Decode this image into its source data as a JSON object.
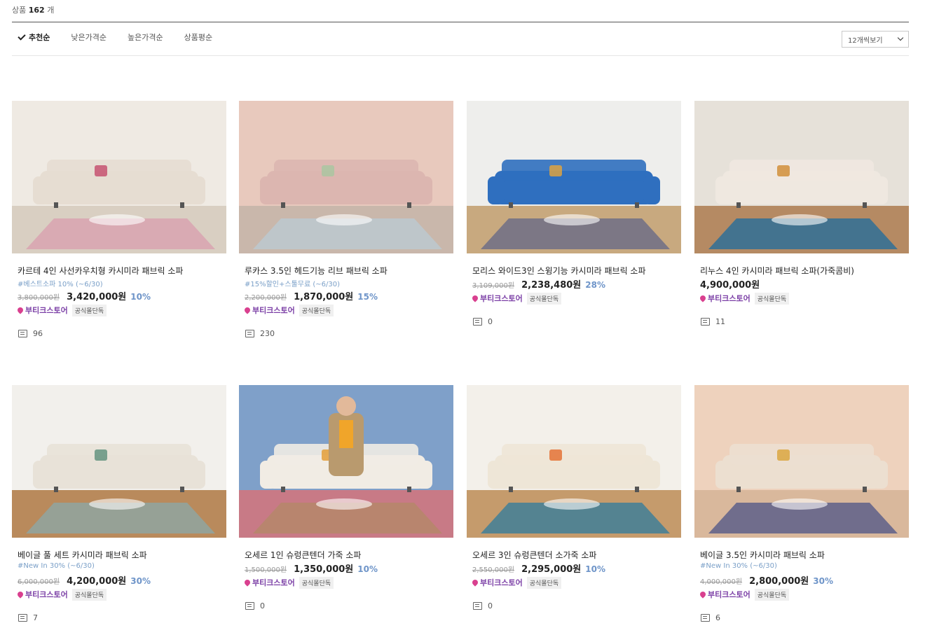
{
  "summary": {
    "prefix": "상품",
    "count": "162",
    "suffix": "개"
  },
  "sort": {
    "options": [
      "추천순",
      "낮은가격순",
      "높은가격순",
      "상품평순"
    ],
    "active_index": 0
  },
  "per_page": {
    "selected": "12개씩보기"
  },
  "colors": {
    "store": "#7b3fa6",
    "pin": "#d9408f",
    "discount": "#6f95c9",
    "promo": "#7ba0c8"
  },
  "products": [
    {
      "title": "카르테 4인 사선카우치형 카시미라 패브릭 소파",
      "promo": "#베스트소파 10% (~6/30)",
      "original_price": "3,800,000원",
      "price": "3,420,000원",
      "discount": "10%",
      "store": "부티크스토어",
      "badge": "공식몰단독",
      "reviews": "96"
    },
    {
      "title": "루카스 3.5인 헤드기능 리브 패브릭 소파",
      "promo": "#15%할인+스툴무료 (~6/30)",
      "original_price": "2,200,000원",
      "price": "1,870,000원",
      "discount": "15%",
      "store": "부티크스토어",
      "badge": "공식몰단독",
      "reviews": "230"
    },
    {
      "title": "모리스 와이드3인 스윙기능 카시미라 패브릭 소파",
      "promo": "",
      "original_price": "3,109,000원",
      "price": "2,238,480원",
      "discount": "28%",
      "store": "부티크스토어",
      "badge": "공식몰단독",
      "reviews": "0"
    },
    {
      "title": "리누스 4인 카시미라 패브릭 소파(가죽콤비)",
      "promo": "",
      "original_price": "",
      "price": "4,900,000원",
      "discount": "",
      "store": "부티크스토어",
      "badge": "공식몰단독",
      "reviews": "11"
    },
    {
      "title": "베이글 풀 세트 카시미라 패브릭 소파",
      "promo": "#New In 30% (~6/30)",
      "original_price": "6,000,000원",
      "price": "4,200,000원",
      "discount": "30%",
      "store": "부티크스토어",
      "badge": "공식몰단독",
      "reviews": "7"
    },
    {
      "title": "오세르 1인 슈렁큰텐더 가죽 소파",
      "promo": "",
      "original_price": "1,500,000원",
      "price": "1,350,000원",
      "discount": "10%",
      "store": "부티크스토어",
      "badge": "공식몰단독",
      "reviews": "0"
    },
    {
      "title": "오세르 3인 슈렁큰텐더 소가죽 소파",
      "promo": "",
      "original_price": "2,550,000원",
      "price": "2,295,000원",
      "discount": "10%",
      "store": "부티크스토어",
      "badge": "공식몰단독",
      "reviews": "0"
    },
    {
      "title": "베이글 3.5인 카시미라 패브릭 소파",
      "promo": "#New In 30% (~6/30)",
      "original_price": "4,000,000원",
      "price": "2,800,000원",
      "discount": "30%",
      "store": "부티크스토어",
      "badge": "공식몰단독",
      "reviews": "6"
    }
  ]
}
